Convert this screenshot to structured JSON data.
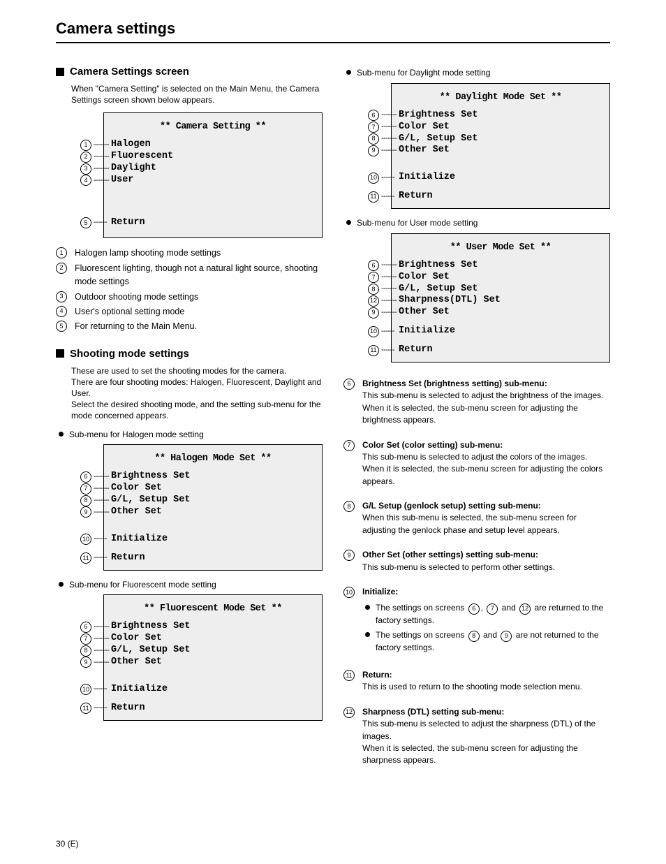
{
  "header": {
    "title": "Camera settings"
  },
  "pageNumber": "30 (E)",
  "left": {
    "sectA": {
      "title": "Camera Settings screen",
      "intro": "When \"Camera Setting\" is selected on the Main Menu, the Camera Settings screen shown below appears.",
      "menu": {
        "title": "** Camera Setting **",
        "items": [
          {
            "num": "1",
            "label": "Halogen"
          },
          {
            "num": "2",
            "label": "Fluorescent"
          },
          {
            "num": "3",
            "label": "Daylight"
          },
          {
            "num": "4",
            "label": "User"
          }
        ],
        "returnNum": "5",
        "returnLabel": "Return"
      },
      "list": [
        {
          "num": "1",
          "text": "Halogen lamp shooting mode settings"
        },
        {
          "num": "2",
          "text": "Fluorescent lighting, though not a natural light source, shooting mode settings"
        },
        {
          "num": "3",
          "text": "Outdoor shooting mode settings"
        },
        {
          "num": "4",
          "text": "User's optional setting mode"
        },
        {
          "num": "5",
          "text": "For returning to the Main Menu."
        }
      ]
    },
    "sectB": {
      "title": "Shooting mode settings",
      "intro": "These are used to set the shooting modes for the camera.\nThere are four shooting modes: Halogen, Fluorescent, Daylight and User.\nSelect the desired shooting mode, and the setting sub-menu for the mode concerned appears.",
      "halogen": {
        "line": "Sub-menu for Halogen mode setting",
        "menu": {
          "title": "** Halogen Mode Set **",
          "items": [
            {
              "num": "6",
              "label": "Brightness Set"
            },
            {
              "num": "7",
              "label": "Color Set"
            },
            {
              "num": "8",
              "label": "G/L, Setup Set"
            },
            {
              "num": "9",
              "label": "Other Set"
            }
          ],
          "initNum": "10",
          "initLabel": "Initialize",
          "returnNum": "11",
          "returnLabel": "Return"
        }
      },
      "fluorescent": {
        "line": "Sub-menu for Fluorescent mode setting",
        "menu": {
          "title": "** Fluorescent Mode Set **",
          "items": [
            {
              "num": "6",
              "label": "Brightness Set"
            },
            {
              "num": "7",
              "label": "Color Set"
            },
            {
              "num": "8",
              "label": "G/L, Setup Set"
            },
            {
              "num": "9",
              "label": "Other Set"
            }
          ],
          "initNum": "10",
          "initLabel": "Initialize",
          "returnNum": "11",
          "returnLabel": "Return"
        }
      }
    }
  },
  "right": {
    "daylight": {
      "line": "Sub-menu for Daylight mode setting",
      "menu": {
        "title": "** Daylight Mode Set **",
        "items": [
          {
            "num": "6",
            "label": "Brightness Set"
          },
          {
            "num": "7",
            "label": "Color Set"
          },
          {
            "num": "8",
            "label": "G/L, Setup Set"
          },
          {
            "num": "9",
            "label": "Other Set"
          }
        ],
        "initNum": "10",
        "initLabel": "Initialize",
        "returnNum": "11",
        "returnLabel": "Return"
      }
    },
    "user": {
      "line": "Sub-menu for User mode setting",
      "menu": {
        "title": "** User Mode Set **",
        "items": [
          {
            "num": "6",
            "label": "Brightness Set"
          },
          {
            "num": "7",
            "label": "Color Set"
          },
          {
            "num": "8",
            "label": "G/L, Setup Set"
          },
          {
            "num": "12",
            "label": "Sharpness(DTL) Set"
          },
          {
            "num": "9",
            "label": "Other Set"
          }
        ],
        "initNum": "10",
        "initLabel": "Initialize",
        "returnNum": "11",
        "returnLabel": "Return"
      }
    },
    "desc": [
      {
        "num": "6",
        "title": "Brightness Set (brightness setting) sub-menu:",
        "body": "This sub-menu is selected to adjust the brightness of the images.\nWhen it is selected, the sub-menu screen for adjusting the brightness appears."
      },
      {
        "num": "7",
        "title": "Color Set (color setting) sub-menu:",
        "body": "This sub-menu is selected to adjust the colors of the images.\nWhen it is selected, the sub-menu screen for adjusting the colors appears."
      },
      {
        "num": "8",
        "title": "G/L Setup (genlock setup) setting sub-menu:",
        "body": "When this sub-menu is selected, the sub-menu screen for adjusting the genlock phase and setup level appears."
      },
      {
        "num": "9",
        "title": "Other Set (other settings) setting sub-menu:",
        "body": "This sub-menu is selected to perform other settings."
      },
      {
        "num": "10",
        "title": "Initialize:",
        "body": "The settings on screens ",
        "body2": ", ",
        "body3": " and ",
        "body4": " are returned to the factory settings.",
        "body5": "The settings on screens ",
        "body6": " and ",
        "body7": " are not returned to the factory settings.",
        "refs": {
          "a": "6",
          "b": "7",
          "c": "12",
          "d": "8",
          "e": "9"
        }
      },
      {
        "num": "11",
        "title": "Return:",
        "body": "This is used to return to the shooting mode selection menu."
      },
      {
        "num": "12",
        "title": "Sharpness (DTL) setting sub-menu:",
        "body": "This sub-menu is selected to adjust the sharpness (DTL) of the images.\nWhen it is selected, the sub-menu screen for adjusting the sharpness appears."
      }
    ]
  }
}
